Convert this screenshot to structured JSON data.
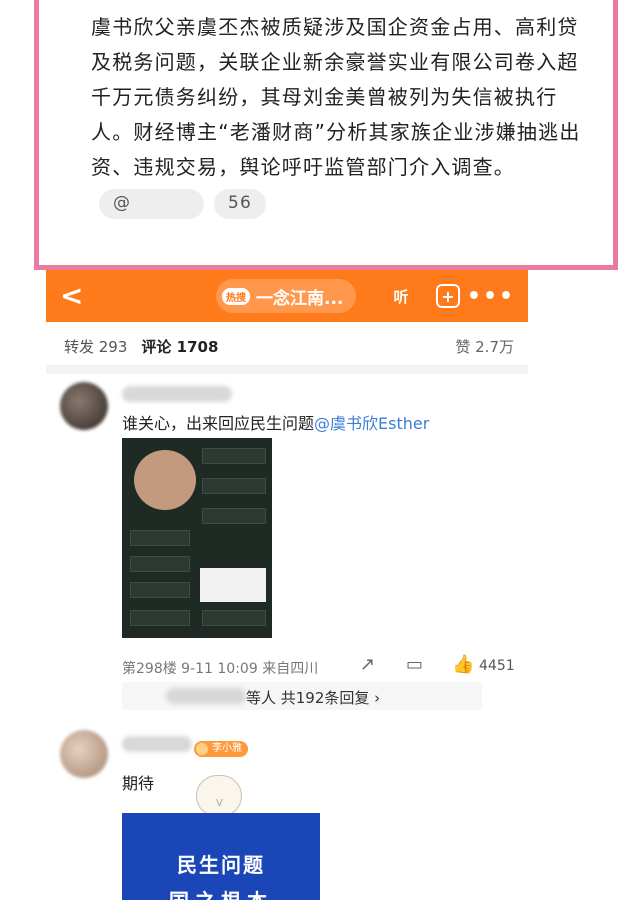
{
  "post": {
    "text": "虞书欣父亲虞丕杰被质疑涉及国企资金占用、高利贷及税务问题，关联企业新余豪誉实业有限公司卷入超千万元债务纠纷，其母刘金美曾被列为失信被执行人。财经博主“老潘财商”分析其家族企业涉嫌抽逃出资、违规交易，舆论呼吁监管部门介入调查。",
    "user_pill": "@",
    "count": "56"
  },
  "colors": {
    "highlight_border": "#e97ba3",
    "topbar": "#ff7a1a",
    "mention": "#3c7ed8",
    "card": "#1a46b8"
  },
  "app": {
    "topbar": {
      "back_icon": "chevron-left-icon",
      "search_badge": "热搜",
      "search_text": "一念江南...",
      "listen_label": "听",
      "plus_icon": "add-icon",
      "more_icon": "more-icon"
    },
    "tabs": {
      "repost": "转发 293",
      "comments": "评论 1708",
      "likes": "赞 2.7万"
    },
    "comment1": {
      "text": "谁关心，出来回应民生问题",
      "mention": "@虞书欣Esther",
      "meta": "第298楼 9-11 10:09 来自四川",
      "like_count": "4451",
      "reply_text": "等人  共192条回复 ›"
    },
    "comment2": {
      "badge": "李小雅",
      "text": "期待",
      "card_line1": "民生问题",
      "card_line2": "国之根本"
    }
  }
}
